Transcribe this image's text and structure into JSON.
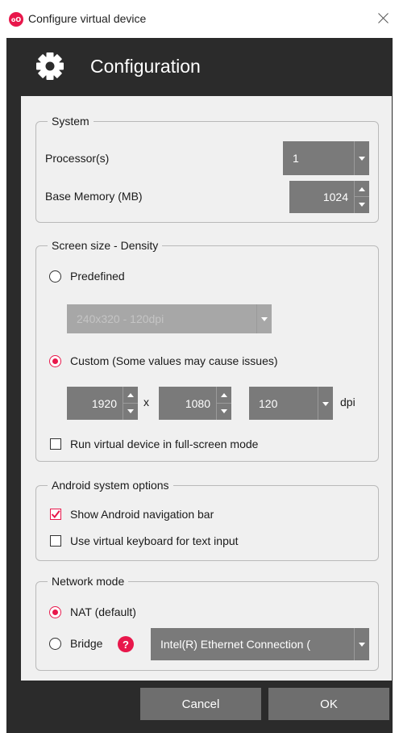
{
  "window": {
    "title": "Configure virtual device",
    "logo_text": "oO"
  },
  "header": {
    "title": "Configuration",
    "icon": "gear-icon"
  },
  "system": {
    "group_title": "System",
    "processors_label": "Processor(s)",
    "processors_value": "1",
    "memory_label": "Base Memory (MB)",
    "memory_value": "1024"
  },
  "screen": {
    "group_title": "Screen size - Density",
    "predefined_label": "Predefined",
    "predefined_selected": false,
    "predefined_value": "240x320 - 120dpi",
    "custom_label": "Custom (Some values may cause issues)",
    "custom_selected": true,
    "width": "1920",
    "x_label": "x",
    "height": "1080",
    "dpi_value": "120",
    "dpi_label": "dpi",
    "fullscreen_label": "Run virtual device in full-screen mode",
    "fullscreen_checked": false
  },
  "android": {
    "group_title": "Android system options",
    "navbar_label": "Show Android navigation bar",
    "navbar_checked": true,
    "keyboard_label": "Use virtual keyboard for text input",
    "keyboard_checked": false
  },
  "network": {
    "group_title": "Network mode",
    "nat_label": "NAT (default)",
    "nat_selected": true,
    "bridge_label": "Bridge",
    "bridge_selected": false,
    "help_glyph": "?",
    "adapter_value": "Intel(R) Ethernet Connection ("
  },
  "buttons": {
    "cancel": "Cancel",
    "ok": "OK"
  },
  "colors": {
    "accent": "#e8174b",
    "dark_bg": "#2b2b2b",
    "panel_bg": "#f0f0f0",
    "control_bg": "#7a7a7a",
    "button_bg": "#6e6e6e"
  }
}
